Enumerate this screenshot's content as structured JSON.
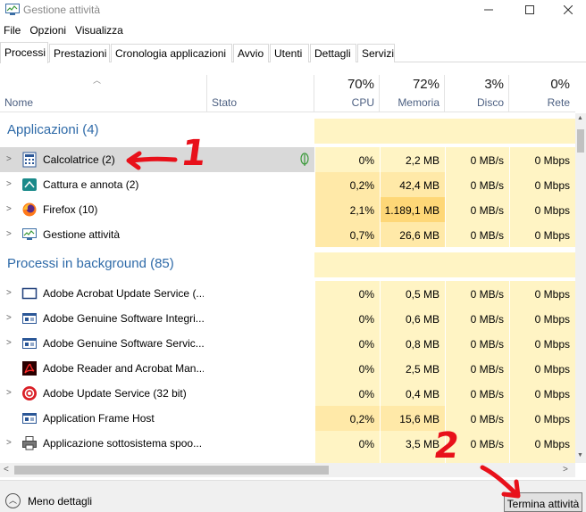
{
  "window": {
    "title": "Gestione attività"
  },
  "menu": [
    "File",
    "Opzioni",
    "Visualizza"
  ],
  "tabs": [
    "Processi",
    "Prestazioni",
    "Cronologia applicazioni",
    "Avvio",
    "Utenti",
    "Dettagli",
    "Servizi"
  ],
  "active_tab": "Processi",
  "columns": {
    "name": "Nome",
    "status": "Stato",
    "cpu": {
      "pct": "70%",
      "label": "CPU"
    },
    "memory": {
      "pct": "72%",
      "label": "Memoria"
    },
    "disk": {
      "pct": "3%",
      "label": "Disco"
    },
    "network": {
      "pct": "0%",
      "label": "Rete"
    }
  },
  "groups": [
    {
      "title": "Applicazioni (4)",
      "rows": [
        {
          "name": "Calcolatrice (2)",
          "icon": "calculator-icon",
          "cpu": "0%",
          "mem": "2,2 MB",
          "disk": "0 MB/s",
          "net": "0 Mbps",
          "selected": true,
          "expandable": true,
          "suspended_leaf": true
        },
        {
          "name": "Cattura e annota (2)",
          "icon": "snip-sketch-icon",
          "cpu": "0,2%",
          "mem": "42,4 MB",
          "disk": "0 MB/s",
          "net": "0 Mbps",
          "expandable": true
        },
        {
          "name": "Firefox (10)",
          "icon": "firefox-icon",
          "cpu": "2,1%",
          "mem": "1.189,1 MB",
          "disk": "0 MB/s",
          "net": "0 Mbps",
          "expandable": true
        },
        {
          "name": "Gestione attività",
          "icon": "task-manager-icon",
          "cpu": "0,7%",
          "mem": "26,6 MB",
          "disk": "0 MB/s",
          "net": "0 Mbps",
          "expandable": true
        }
      ]
    },
    {
      "title": "Processi in background (85)",
      "rows": [
        {
          "name": "Adobe Acrobat Update Service (...",
          "icon": "service-window-icon",
          "cpu": "0%",
          "mem": "0,5 MB",
          "disk": "0 MB/s",
          "net": "0 Mbps",
          "expandable": true
        },
        {
          "name": "Adobe Genuine Software Integri...",
          "icon": "service-app-icon",
          "cpu": "0%",
          "mem": "0,6 MB",
          "disk": "0 MB/s",
          "net": "0 Mbps",
          "expandable": true
        },
        {
          "name": "Adobe Genuine Software Servic...",
          "icon": "service-app-icon",
          "cpu": "0%",
          "mem": "0,8 MB",
          "disk": "0 MB/s",
          "net": "0 Mbps",
          "expandable": true
        },
        {
          "name": "Adobe Reader and Acrobat Man...",
          "icon": "acrobat-icon",
          "cpu": "0%",
          "mem": "2,5 MB",
          "disk": "0 MB/s",
          "net": "0 Mbps",
          "expandable": true
        },
        {
          "name": "Adobe Update Service (32 bit)",
          "icon": "adobe-cc-icon",
          "cpu": "0%",
          "mem": "0,4 MB",
          "disk": "0 MB/s",
          "net": "0 Mbps",
          "expandable": true
        },
        {
          "name": "Application Frame Host",
          "icon": "service-app-icon",
          "cpu": "0,2%",
          "mem": "15,6 MB",
          "disk": "0 MB/s",
          "net": "0 Mbps",
          "expandable": false
        },
        {
          "name": "Applicazione sottosistema spoo...",
          "icon": "printer-icon",
          "cpu": "0%",
          "mem": "3,5 MB",
          "disk": "0 MB/s",
          "net": "0 Mbps",
          "expandable": true
        }
      ]
    }
  ],
  "footer": {
    "fewer_details": "Meno dettagli",
    "end_task": "Termina attività"
  },
  "annotations": [
    "1",
    "2"
  ],
  "colors": {
    "group_title": "#2e6aa8",
    "heat_light": "#fff4c4",
    "heat_medium": "#ffe9a8",
    "heat_strong": "#fed777",
    "annotation": "#e8101a"
  }
}
